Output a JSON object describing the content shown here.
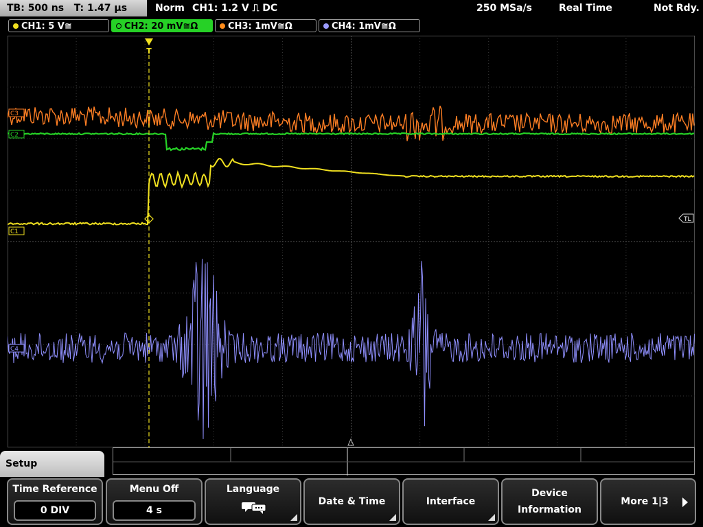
{
  "status": {
    "timebase": "TB: 500 ns",
    "trigger_time": "T: 1.47 µs",
    "mode": "Norm",
    "trigger": "CH1: 1.2 V ⎍ DC",
    "sample_rate": "250 MSa/s",
    "acq_mode": "Real Time",
    "state": "Not Rdy."
  },
  "channels": [
    {
      "label": "CH1: 5 V≅",
      "color": "#f0e020"
    },
    {
      "label": "CH2: 20 mV≅Ω",
      "color": "#26d126"
    },
    {
      "label": "CH3: 1mV≅Ω",
      "color": "#ff8c1a"
    },
    {
      "label": "CH4: 1mV≅Ω",
      "color": "#9a9aff"
    }
  ],
  "markers": {
    "c3": "C3",
    "c2": "C2",
    "c1": "C1",
    "c4": "C4",
    "trigger_level": "TL"
  },
  "colors": {
    "ch1": "#f0e020",
    "ch2": "#26d126",
    "ch3": "#ff7f24",
    "ch4": "#9090ff",
    "grid": "#5a5a5a"
  },
  "menu": {
    "tab": "Setup",
    "softkeys": [
      {
        "label": "Time Reference",
        "value": "0 DIV"
      },
      {
        "label": "Menu Off",
        "value": "4 s"
      },
      {
        "label": "Language",
        "icon": "speech-bubble-icon"
      },
      {
        "label": "Date & Time"
      },
      {
        "label": "Interface"
      },
      {
        "label": "Device",
        "label2": "Information"
      },
      {
        "label": "More 1|3"
      }
    ]
  }
}
